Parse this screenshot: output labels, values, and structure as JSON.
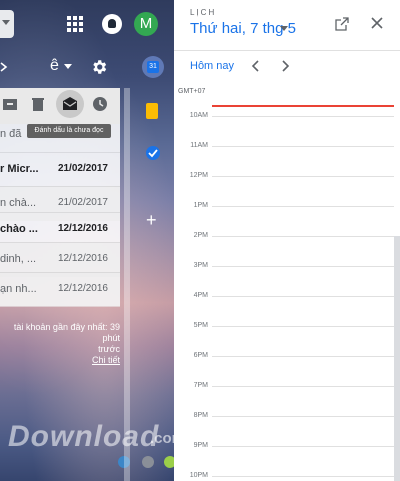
{
  "gmail": {
    "toolbar2_e": "ê",
    "tooltip": "Đánh dấu là chưa đọc",
    "rows": [
      {
        "sender": "r Micr...",
        "date": "21/02/2017",
        "state": "unread"
      },
      {
        "sender": "n chà...",
        "date": "21/02/2017",
        "state": "read"
      },
      {
        "sender": "chào ...",
        "date": "12/12/2016",
        "state": "unread"
      },
      {
        "sender": "dinh, ...",
        "date": "12/12/2016",
        "state": "read"
      },
      {
        "sender": "ạn nh...",
        "date": "12/12/2016",
        "state": "read"
      }
    ],
    "partial_label": "n đã",
    "footer_line1": "tài khoản gần đây nhất: 39 phút",
    "footer_line2": "trước",
    "footer_link": "Chi tiết",
    "avatar_letter": "M",
    "watermark": "Download",
    "watermark_small": ".com.vn",
    "dots": [
      "#3b86c8",
      "#8a8f98",
      "#9bcf4a",
      "#f5c242",
      "#5aa9e6",
      "#e86d6d"
    ]
  },
  "side": {
    "calendar_badge": "31",
    "plus": "+"
  },
  "calendar": {
    "label": "LỊCH",
    "date_title": "Thứ hai, 7 thg 5",
    "today_button": "Hôm nay",
    "timezone": "GMT+07",
    "hours": [
      "10AM",
      "11AM",
      "12PM",
      "1PM",
      "2PM",
      "3PM",
      "4PM",
      "5PM",
      "6PM",
      "7PM",
      "8PM",
      "9PM",
      "10PM"
    ],
    "accent_color": "#1a73e8",
    "now_color": "#ea4335"
  }
}
